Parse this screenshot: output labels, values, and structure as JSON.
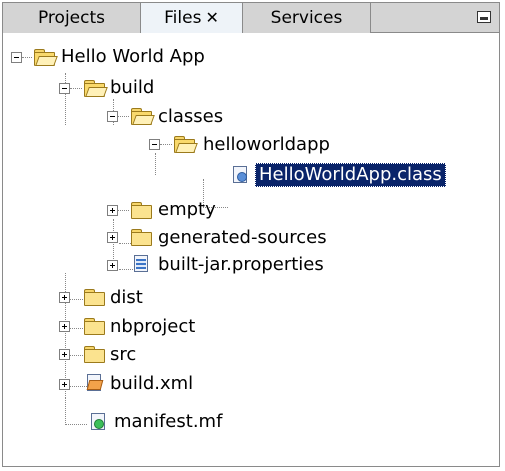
{
  "tabs": [
    {
      "label": "Projects",
      "active": false
    },
    {
      "label": "Files",
      "active": true,
      "close": "✕"
    },
    {
      "label": "Services",
      "active": false
    }
  ],
  "tree": {
    "root": "Hello World App",
    "build": "build",
    "classes": "classes",
    "helloworldapp": "helloworldapp",
    "helloworldapp_class": "HelloWorldApp.class",
    "empty": "empty",
    "generated_sources": "generated-sources",
    "built_jar_properties": "built-jar.properties",
    "dist": "dist",
    "nbproject": "nbproject",
    "src": "src",
    "build_xml": "build.xml",
    "manifest_mf": "manifest.mf"
  },
  "colors": {
    "selection": "#0a246a",
    "folder": "#fbe38f",
    "tab_bar": "#d4d4d4"
  }
}
